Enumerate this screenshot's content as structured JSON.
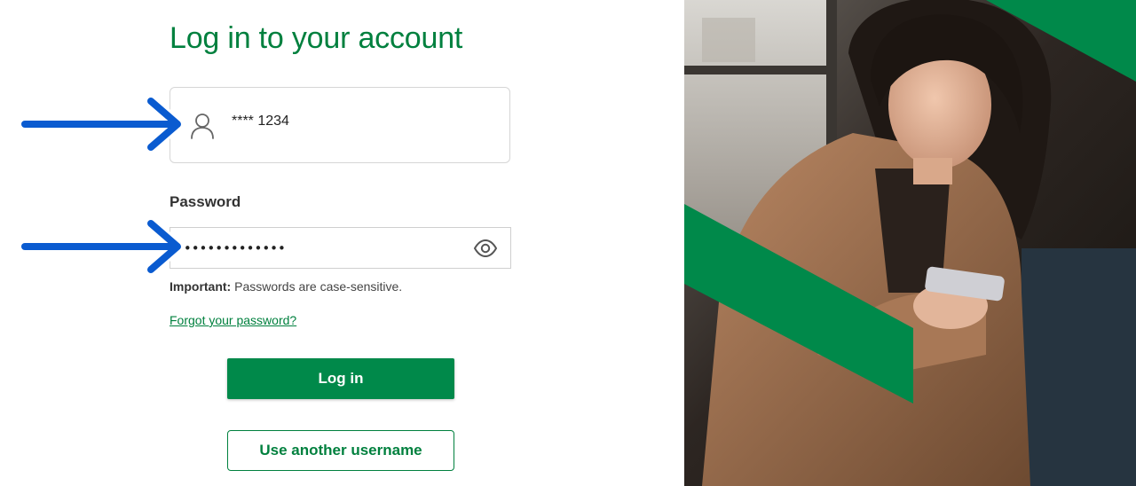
{
  "page": {
    "title": "Log in to your account"
  },
  "username": {
    "icon": "user-icon",
    "value": "**** 1234"
  },
  "password": {
    "label": "Password",
    "value": "••••••••••••••",
    "toggle_icon": "eye-icon"
  },
  "notice": {
    "strong": "Important:",
    "text": " Passwords are case-sensitive."
  },
  "links": {
    "forgot": "Forgot your password?"
  },
  "buttons": {
    "login": "Log in",
    "other_username": "Use another username"
  },
  "annotations": {
    "arrow_icon": "arrow-right-icon",
    "arrow_color": "#0a5bd0"
  },
  "photo": {
    "description_icon": "woman-with-phone-photo"
  },
  "colors": {
    "brand_green": "#00803e",
    "button_green": "#00894a"
  }
}
